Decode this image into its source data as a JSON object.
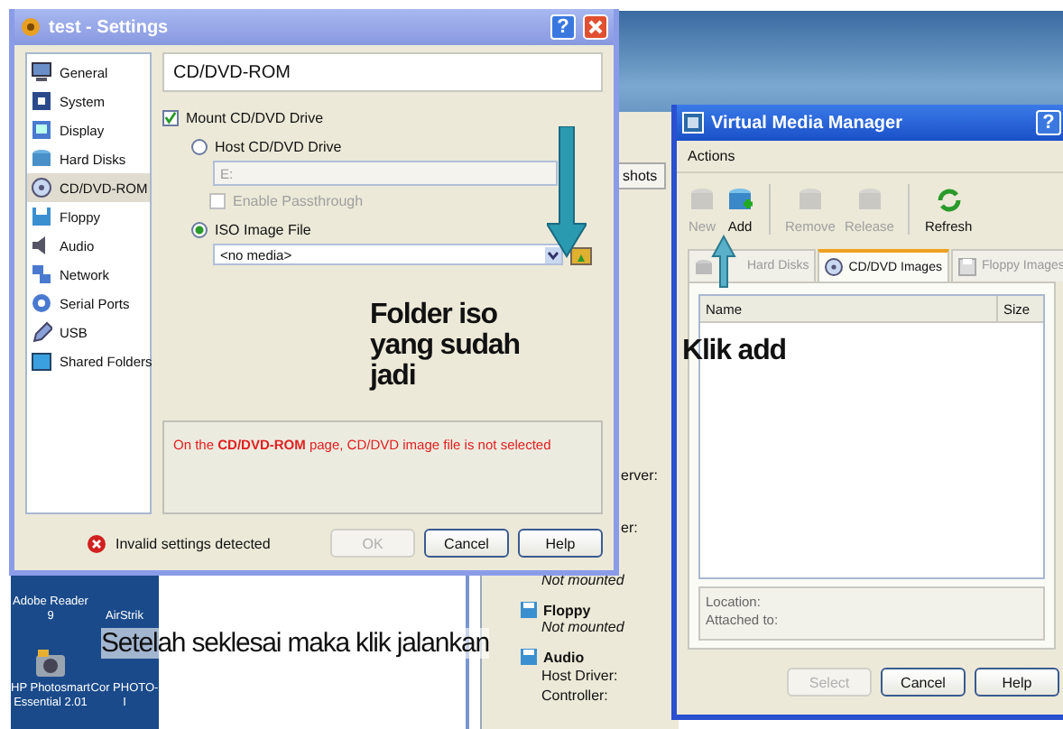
{
  "desktop": {
    "icons": [
      {
        "label": "Adobe Reader 9"
      },
      {
        "label": "AirStrik"
      },
      {
        "label": "HP Photosmart Essential 2.01"
      },
      {
        "label": "Cor PHOTO-I"
      }
    ]
  },
  "main_window": {
    "tab": "shots",
    "field_labels": [
      "erver:",
      "er:"
    ],
    "details": [
      {
        "kind": "status",
        "text": "Not mounted"
      },
      {
        "kind": "heading",
        "text": "Floppy"
      },
      {
        "kind": "status",
        "text": "Not mounted"
      },
      {
        "kind": "heading",
        "text": "Audio"
      },
      {
        "kind": "field",
        "text": "Host Driver:"
      },
      {
        "kind": "field",
        "text": "Controller:"
      }
    ]
  },
  "settings": {
    "title": "test - Settings",
    "help_glyph": "?",
    "sidebar": [
      {
        "label": "General",
        "selected": false
      },
      {
        "label": "System",
        "selected": false
      },
      {
        "label": "Display",
        "selected": false
      },
      {
        "label": "Hard Disks",
        "selected": false
      },
      {
        "label": "CD/DVD-ROM",
        "selected": true
      },
      {
        "label": "Floppy",
        "selected": false
      },
      {
        "label": "Audio",
        "selected": false
      },
      {
        "label": "Network",
        "selected": false
      },
      {
        "label": "Serial Ports",
        "selected": false
      },
      {
        "label": "USB",
        "selected": false
      },
      {
        "label": "Shared Folders",
        "selected": false
      }
    ],
    "page_title": "CD/DVD-ROM",
    "mount": {
      "label": "Mount CD/DVD Drive",
      "checked": true
    },
    "host_drive": {
      "label": "Host CD/DVD Drive",
      "selected": false
    },
    "drive_field": {
      "value": "E:",
      "disabled": true
    },
    "passthrough": {
      "label": "Enable Passthrough",
      "checked": false,
      "disabled": true
    },
    "iso": {
      "label": "ISO Image File",
      "selected": true
    },
    "iso_combo": {
      "value": "<no media>"
    },
    "error_message": "On the **CD/DVD-ROM** page, CD/DVD image file is not selected",
    "status": "Invalid settings detected",
    "buttons": [
      {
        "label": "OK",
        "disabled": true
      },
      {
        "label": "Cancel",
        "disabled": false
      },
      {
        "label": "Help",
        "disabled": false
      }
    ]
  },
  "media_manager": {
    "title": "Virtual Media Manager",
    "help_glyph": "?",
    "menu": [
      "Actions"
    ],
    "toolbar": [
      {
        "label": "New",
        "disabled": true
      },
      {
        "label": "Add",
        "disabled": false
      },
      {
        "label": "Remove",
        "disabled": true
      },
      {
        "label": "Release",
        "disabled": true
      },
      {
        "label": "Refresh",
        "disabled": false
      }
    ],
    "tabs": [
      {
        "label": "Hard Disks",
        "selected": false
      },
      {
        "label": "CD/DVD Images",
        "selected": true
      },
      {
        "label": "Floppy Images",
        "selected": false
      }
    ],
    "columns": [
      "Name",
      "Size"
    ],
    "info": [
      "Location:",
      "Attached to:"
    ],
    "buttons": [
      {
        "label": "Select",
        "disabled": true
      },
      {
        "label": "Cancel",
        "disabled": false
      },
      {
        "label": "Help",
        "disabled": false
      }
    ]
  },
  "annotations": [
    {
      "text": "Folder iso yang sudah jadi"
    },
    {
      "text": "Klik add"
    },
    {
      "text": "Setelah seklesai maka klik jalankan"
    }
  ]
}
